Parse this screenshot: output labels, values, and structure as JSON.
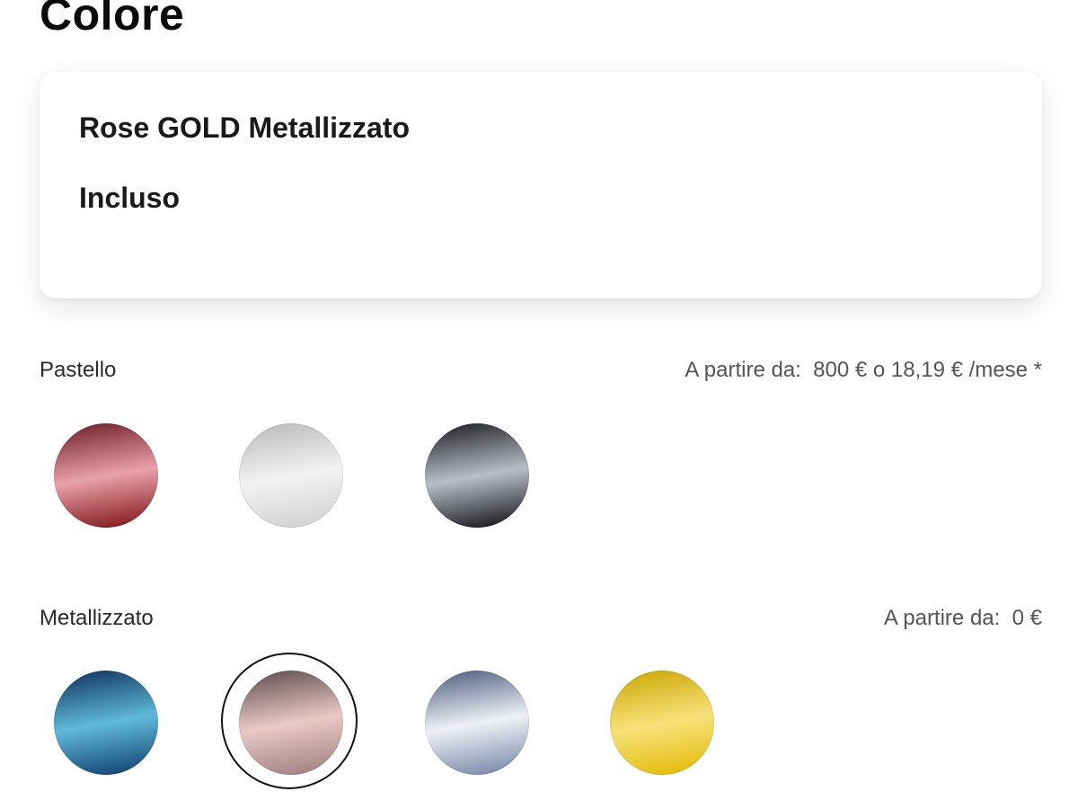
{
  "page": {
    "title": "Colore"
  },
  "selection": {
    "name": "Rose GOLD Metallizzato",
    "price": "Incluso"
  },
  "groups": [
    {
      "label": "Pastello",
      "price_text": "A partire da:  800 € o 18,19 € /mese *",
      "swatches": [
        {
          "name": "red",
          "top": "#6b1a24",
          "mid": "#e8a0a8",
          "bottom": "#7a0c12"
        },
        {
          "name": "white",
          "top": "#b8b8b8",
          "mid": "#f2f2f2",
          "bottom": "#cfcfcf"
        },
        {
          "name": "black",
          "top": "#1a1a1f",
          "mid": "#b8bcc4",
          "bottom": "#0b0b10"
        }
      ]
    },
    {
      "label": "Metallizzato",
      "price_text": "A partire da:  0 €",
      "swatches": [
        {
          "name": "blue",
          "top": "#0e2f5c",
          "mid": "#5fb8d8",
          "bottom": "#0b3a6a"
        },
        {
          "name": "rose-gold",
          "top": "#5a4a4c",
          "mid": "#e9c8c6",
          "bottom": "#9a7a7c",
          "selected": true
        },
        {
          "name": "silver-blue",
          "top": "#4a5a7c",
          "mid": "#eef0f4",
          "bottom": "#6f80a4"
        },
        {
          "name": "yellow",
          "top": "#caa400",
          "mid": "#f7e27a",
          "bottom": "#e2b800"
        }
      ]
    }
  ]
}
